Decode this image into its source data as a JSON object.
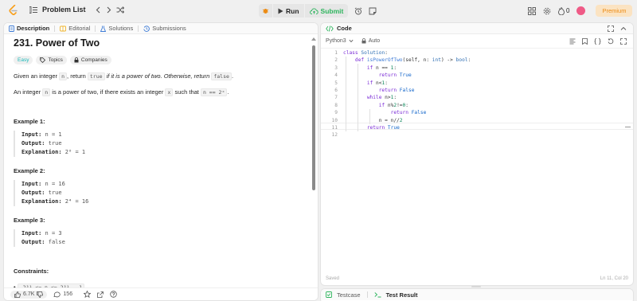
{
  "topbar": {
    "problem_list": "Problem List",
    "run": "Run",
    "submit": "Submit",
    "points": "0",
    "premium": "Premium",
    "colors": {
      "submit": "#2db55d",
      "premium": "#ec8b13",
      "logo": "#f89f1b"
    }
  },
  "left_tabs": [
    {
      "label": "Description",
      "icon": "file-text-icon"
    },
    {
      "label": "Editorial",
      "icon": "book-icon"
    },
    {
      "label": "Solutions",
      "icon": "flask-icon"
    },
    {
      "label": "Submissions",
      "icon": "history-icon"
    }
  ],
  "problem": {
    "title": "231. Power of Two",
    "difficulty": "Easy",
    "topics": "Topics",
    "companies": "Companies",
    "para1": {
      "a": "Given an integer ",
      "code1": "n",
      "b": ", return ",
      "code2": "true",
      "c": " if it is a power of two. Otherwise, return ",
      "code3": "false",
      "d": "."
    },
    "para2": {
      "a": "An integer ",
      "code1": "n",
      "b": " is a power of two, if there exists an integer ",
      "code2": "x",
      "c": " such that ",
      "code3": "n == 2ˣ",
      "d": "."
    },
    "examples": [
      {
        "title": "Example 1:",
        "input_label": "Input:",
        "input": "n = 1",
        "output_label": "Output:",
        "output": "true",
        "expl_label": "Explanation:",
        "expl": "2⁰ = 1"
      },
      {
        "title": "Example 2:",
        "input_label": "Input:",
        "input": "n = 16",
        "output_label": "Output:",
        "output": "true",
        "expl_label": "Explanation:",
        "expl": "2⁴ = 16"
      },
      {
        "title": "Example 3:",
        "input_label": "Input:",
        "input": "n = 3",
        "output_label": "Output:",
        "output": "false"
      }
    ],
    "constraints_title": "Constraints:",
    "constraint": "-2³¹ <= n <= 2³¹ - 1"
  },
  "left_footer": {
    "likes": "6.7K",
    "comments": "156"
  },
  "code": {
    "tab": "Code",
    "language": "Python3",
    "mode": "Auto",
    "saved": "Saved",
    "cursor": "Ln 11, Col 20",
    "line_numbers": [
      "1",
      "2",
      "3",
      "4",
      "5",
      "6",
      "7",
      "8",
      "9",
      "10",
      "11",
      "12"
    ]
  },
  "bottom": {
    "testcase": "Testcase",
    "test_result": "Test Result"
  }
}
